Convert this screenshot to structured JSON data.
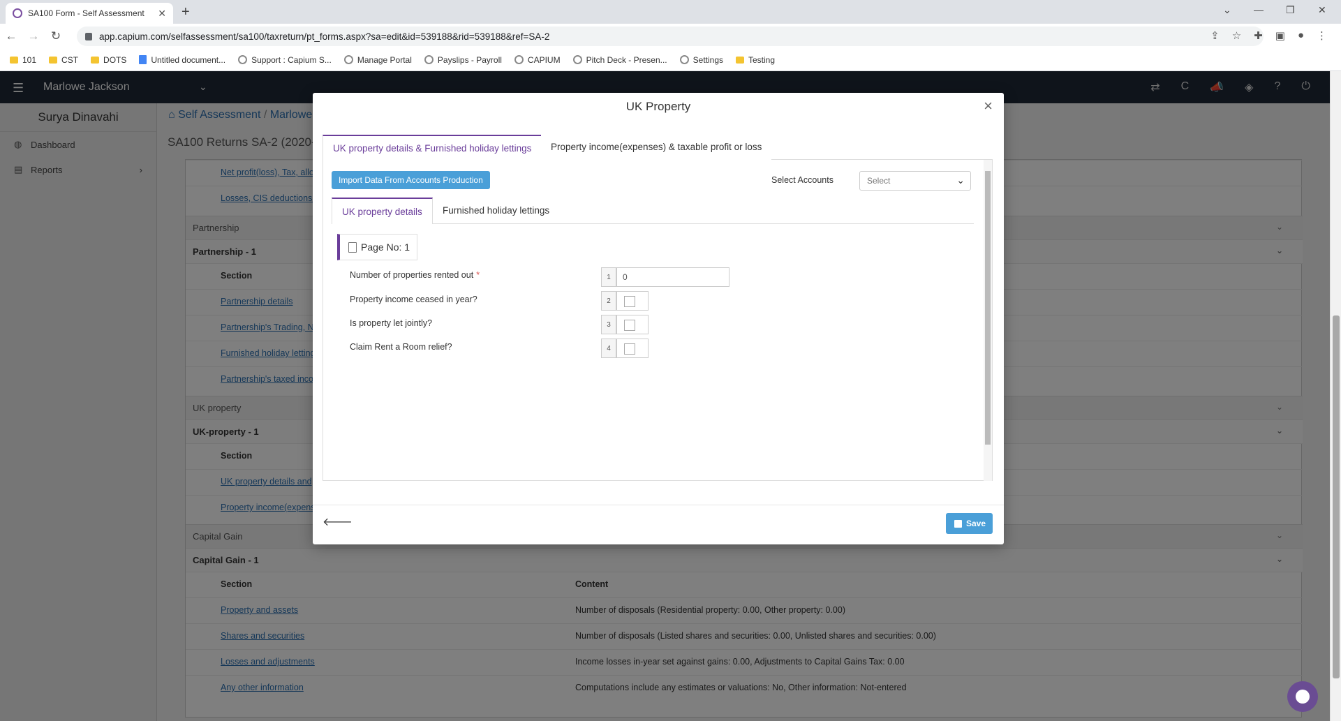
{
  "browser": {
    "tab_title": "SA100 Form - Self Assessment",
    "url": "app.capium.com/selfassessment/sa100/taxreturn/pt_forms.aspx?sa=edit&id=539188&rid=539188&ref=SA-2",
    "bookmarks": [
      "101",
      "CST",
      "DOTS",
      "Untitled document...",
      "Support : Capium S...",
      "Manage Portal",
      "Payslips - Payroll",
      "CAPIUM",
      "Pitch Deck - Presen...",
      "Settings",
      "Testing"
    ]
  },
  "app": {
    "client_name": "Marlowe Jackson",
    "sidebar_user": "Surya Dinavahi",
    "sidebar_items": [
      "Dashboard",
      "Reports"
    ],
    "breadcrumb_1": "Self Assessment",
    "breadcrumb_2": "Marlowe",
    "page_title": "SA100 Returns SA-2 (2020-21)"
  },
  "background_list": {
    "rows_top": [
      "Net profit(loss), Tax, allow",
      "Losses, CIS deductions a"
    ],
    "partnership_head": "Partnership",
    "partnership_sub": "Partnership - 1",
    "section_label": "Section",
    "content_label": "Content",
    "partnership_rows": [
      "Partnership details",
      "Partnership's Trading, NI",
      "Furnished holiday letting",
      "Partnership's taxed incon"
    ],
    "ukprop_head": "UK property",
    "ukprop_sub": "UK-property - 1",
    "ukprop_rows": [
      "UK property details and",
      "Property income(expens"
    ],
    "cg_head": "Capital Gain",
    "cg_sub": "Capital Gain - 1",
    "cg_rows": [
      {
        "section": "Property and assets",
        "content": "Number of disposals (Residential property: 0.00, Other property: 0.00)"
      },
      {
        "section": "Shares and securities",
        "content": "Number of disposals (Listed shares and securities: 0.00, Unlisted shares and securities: 0.00)"
      },
      {
        "section": "Losses and adjustments",
        "content": "Income losses in-year set against gains: 0.00, Adjustments to Capital Gains Tax: 0.00"
      },
      {
        "section": "Any other information",
        "content": "Computations include any estimates or valuations: No, Other information: Not-entered"
      }
    ]
  },
  "modal": {
    "title": "UK Property",
    "close": "×",
    "tabs": [
      "UK property details & Furnished holiday lettings",
      "Property income(expenses) & taxable profit or loss"
    ],
    "import_button": "Import Data From Accounts Production",
    "select_accounts_label": "Select Accounts",
    "select_value": "Select",
    "inner_tabs": [
      "UK property details",
      "Furnished holiday lettings"
    ],
    "page_no": "Page No: 1",
    "questions": [
      {
        "num": "1",
        "label": "Number of properties rented out",
        "required": "*",
        "value": "0"
      },
      {
        "num": "2",
        "label": "Property income ceased in year?"
      },
      {
        "num": "3",
        "label": "Is property let jointly?"
      },
      {
        "num": "4",
        "label": "Claim Rent a Room relief?"
      }
    ],
    "back": "🡐",
    "save_button": "Save"
  },
  "colors": {
    "accent": "#6a3d9a",
    "button_blue": "#4a9fd8",
    "header_dark": "#1f2937"
  }
}
